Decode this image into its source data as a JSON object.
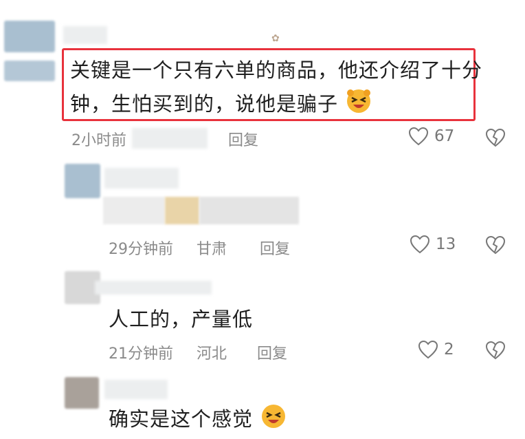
{
  "comments": [
    {
      "text_line1": "关键是一个只有六单的商品，他还介绍了十分",
      "text_line2": "钟，生怕买到的，说他是骗子",
      "time": "2小时前",
      "reply_label": "回复",
      "likes": "67"
    },
    {
      "time": "29分钟前",
      "location": "甘肃",
      "reply_label": "回复",
      "likes": "13"
    },
    {
      "text": "人工的，产量低",
      "time": "21分钟前",
      "location": "河北",
      "reply_label": "回复",
      "likes": "2"
    },
    {
      "text": "确实是这个感觉"
    }
  ],
  "colors": {
    "highlight_border": "#e8323c",
    "meta_text": "#8a8a8a",
    "avatar_blue": "#a9bfd0",
    "avatar_gray": "#d8d8d8",
    "avatar_brown": "#a9a19a"
  },
  "icons": {
    "like": "heart-outline-icon",
    "dislike": "broken-heart-icon",
    "emoji_1": "laughing-face-emoji",
    "emoji_2": "laughing-face-emoji"
  }
}
